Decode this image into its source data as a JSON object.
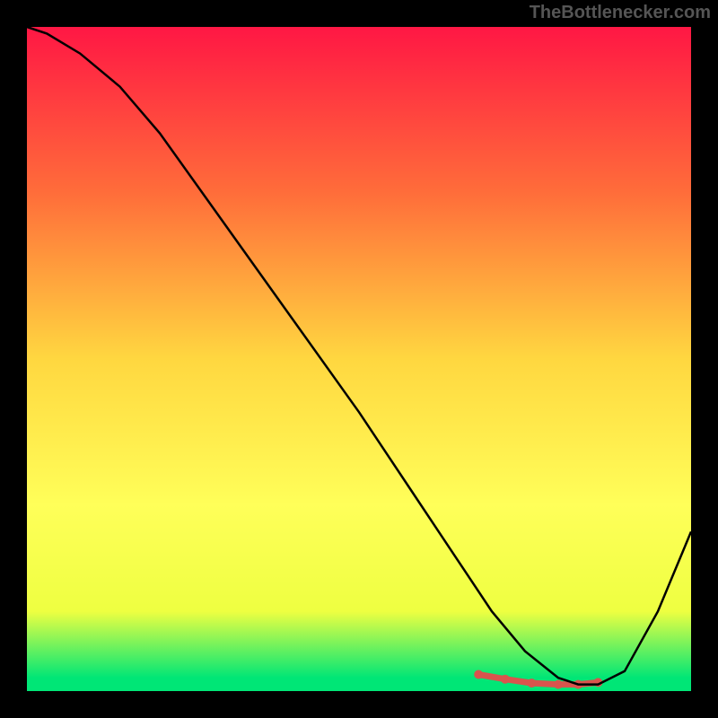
{
  "watermark": "TheBottlenecker.com",
  "chart_data": {
    "type": "line",
    "title": "",
    "xlabel": "",
    "ylabel": "",
    "xlim": [
      0,
      100
    ],
    "ylim": [
      0,
      100
    ],
    "gradient_stops": [
      {
        "offset": 0,
        "color": "#ff1744"
      },
      {
        "offset": 25,
        "color": "#ff6d3a"
      },
      {
        "offset": 50,
        "color": "#ffd740"
      },
      {
        "offset": 72,
        "color": "#ffff59"
      },
      {
        "offset": 88,
        "color": "#eeff41"
      },
      {
        "offset": 98,
        "color": "#00e676"
      }
    ],
    "series": [
      {
        "name": "curve",
        "color": "#000000",
        "x": [
          0,
          3,
          8,
          14,
          20,
          30,
          40,
          50,
          58,
          62,
          66,
          70,
          75,
          80,
          83,
          86,
          90,
          95,
          100
        ],
        "y": [
          100,
          99,
          96,
          91,
          84,
          70,
          56,
          42,
          30,
          24,
          18,
          12,
          6,
          2,
          1,
          1,
          3,
          12,
          24
        ]
      }
    ],
    "highlight": {
      "name": "optimal-zone",
      "color": "#d9544d",
      "x": [
        68,
        72,
        76,
        80,
        83,
        86
      ],
      "y": [
        2.5,
        1.8,
        1.2,
        1.0,
        1.0,
        1.3
      ]
    }
  }
}
